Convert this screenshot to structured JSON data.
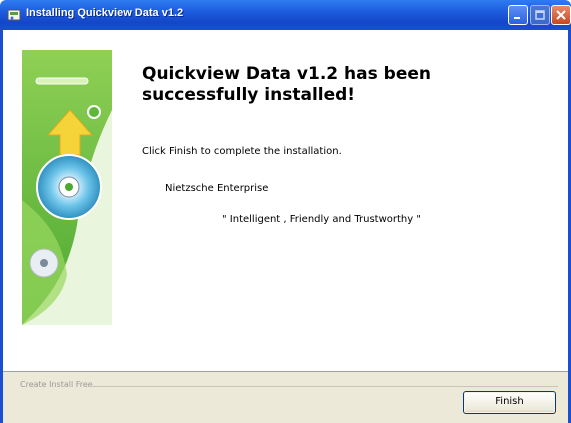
{
  "window": {
    "title": "Installing Quickview Data v1.2",
    "icon": "installer-app-icon"
  },
  "caption_buttons": [
    "minimize-icon",
    "maximize-icon",
    "close-icon"
  ],
  "banner": {
    "icons": [
      "arrow-up-icon",
      "cd-disc-icon",
      "cd-disc-icon"
    ]
  },
  "content": {
    "heading": "Quickview Data v1.2 has been successfully installed!",
    "instruction": "Click Finish to complete the installation.",
    "company": "Nietzsche Enterprise",
    "tagline": "\" Intelligent , Friendly and Trustworthy \""
  },
  "footer": {
    "brand": "Create Install Free",
    "finish_label": "Finish"
  },
  "colors": {
    "titlebar": "#1f5fe0",
    "banner_green": "#7cc242",
    "panel": "#ece9d8"
  }
}
